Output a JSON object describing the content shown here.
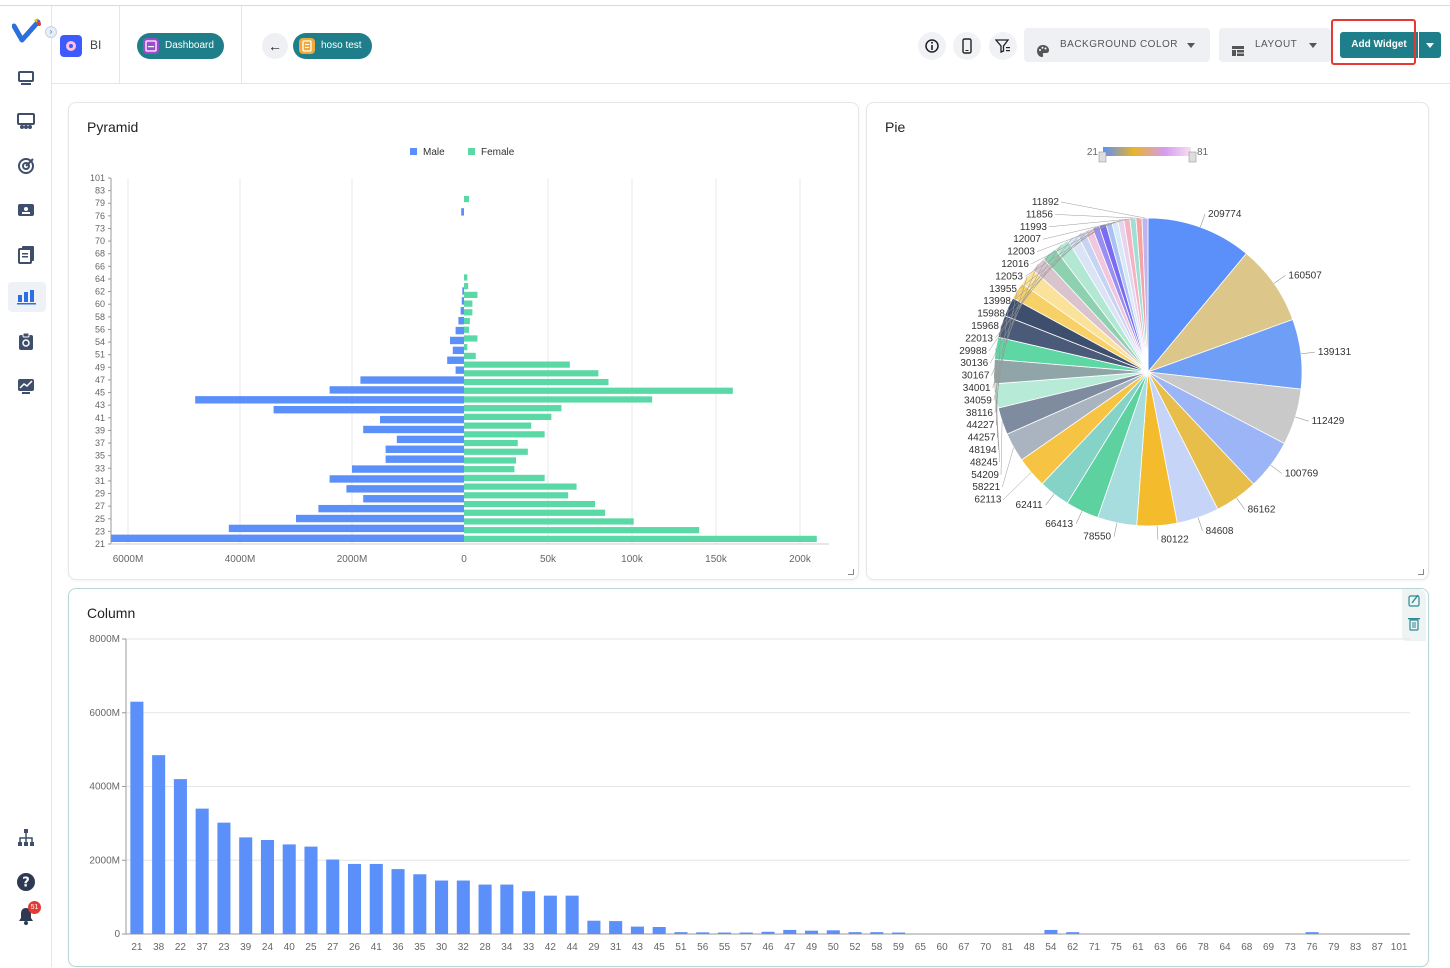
{
  "app": {
    "section_label": "BI"
  },
  "breadcrumb": {
    "dashboard_label": "Dashboard",
    "report_label": "hoso test"
  },
  "toolbar": {
    "background_color_label": "BACKGROUND COLOR",
    "layout_label": "LAYOUT",
    "add_widget_label": "Add Widget"
  },
  "sidebar": {
    "items": [
      {
        "icon": "monitor-icon"
      },
      {
        "icon": "people-icon"
      },
      {
        "icon": "target-icon"
      },
      {
        "icon": "id-card-icon"
      },
      {
        "icon": "documents-icon"
      },
      {
        "icon": "bar-chart-icon",
        "active": true
      },
      {
        "icon": "clipboard-icon"
      },
      {
        "icon": "line-chart-icon"
      },
      {
        "icon": "org-chart-icon"
      },
      {
        "icon": "help-icon"
      },
      {
        "icon": "bell-icon",
        "badge": "51"
      }
    ]
  },
  "widgets": {
    "pyramid": {
      "title": "Pyramid"
    },
    "pie": {
      "title": "Pie"
    },
    "column": {
      "title": "Column"
    }
  },
  "chart_data": [
    {
      "type": "bar",
      "orientation": "horizontal-diverging",
      "title": "Pyramid",
      "legend": {
        "position": "top-center",
        "entries": [
          "Male",
          "Female"
        ]
      },
      "colors": {
        "Male": "#5b8ff9",
        "Female": "#5ad8a6"
      },
      "categories": [
        "101",
        "83",
        "79",
        "76",
        "73",
        "70",
        "68",
        "66",
        "64",
        "62",
        "60",
        "58",
        "56",
        "54",
        "51",
        "49",
        "47",
        "45",
        "43",
        "41",
        "39",
        "37",
        "35",
        "33",
        "31",
        "29",
        "27",
        "25",
        "23",
        "21"
      ],
      "left_axis_ticks": [
        "6000M",
        "4000M",
        "2000M",
        "0"
      ],
      "right_axis_ticks": [
        "50k",
        "100k",
        "150k",
        "200k"
      ],
      "series": [
        {
          "name": "Male",
          "unit": "M",
          "values": [
            0,
            0,
            0,
            50,
            0,
            0,
            0,
            0,
            0,
            0,
            0,
            30,
            40,
            60,
            100,
            150,
            250,
            200,
            300,
            150,
            1850,
            2400,
            4800,
            3400,
            1500,
            1800,
            1200,
            1400,
            1400,
            2000,
            2400,
            2100,
            1800,
            2600,
            3000,
            4200,
            6300
          ]
        },
        {
          "name": "Female",
          "values": [
            0,
            0,
            3000,
            0,
            0,
            0,
            0,
            0,
            0,
            0,
            0,
            2000,
            2500,
            8000,
            5000,
            5000,
            3500,
            3000,
            8000,
            2000,
            7000,
            63000,
            80000,
            86000,
            160000,
            112000,
            58000,
            52000,
            40000,
            48000,
            32000,
            38000,
            31000,
            30000,
            48000,
            67000,
            62000,
            78000,
            84000,
            101000,
            140000,
            210000
          ]
        }
      ]
    },
    {
      "type": "pie",
      "title": "Pie",
      "range_slider": {
        "min_label": "21",
        "max_label": "81"
      },
      "values": [
        209774,
        160507,
        139131,
        112429,
        100769,
        86162,
        84608,
        80122,
        78550,
        66413,
        62411,
        62113,
        58221,
        54209,
        48245,
        48194,
        44257,
        44227,
        38116,
        34059,
        34001,
        30167,
        30136,
        29988,
        22013,
        15968,
        15988,
        13998,
        13955,
        12053,
        12016,
        12003,
        12007,
        11993,
        11856,
        11892
      ],
      "colors": [
        "#5b8ff9",
        "#dcc68a",
        "#6e9ef5",
        "#c9c9c9",
        "#9bb5f7",
        "#e8be4a",
        "#c5d4f7",
        "#f4bc2c",
        "#a8dde0",
        "#5dd2a0",
        "#85d3c6",
        "#f6c343",
        "#aab4c0",
        "#7f8ca0",
        "#b7ebd8",
        "#8fa5a8",
        "#5fd7a4",
        "#4b5a78",
        "#3e4f6e",
        "#f7d068",
        "#fbe29a",
        "#d9c3cd",
        "#8ed1b0",
        "#b1e7d3",
        "#dbe4f5",
        "#c7d3f2",
        "#f0c7dd",
        "#9a8ff0",
        "#7a6cf2",
        "#a9c2f3",
        "#d8e8f9",
        "#e6d5f0",
        "#f7b2c0",
        "#9fdfd6",
        "#f5a3a3",
        "#c1b3f0"
      ]
    },
    {
      "type": "bar",
      "title": "Column",
      "ylabel": "",
      "ylim": [
        0,
        8000
      ],
      "y_ticks": [
        "0",
        "2000M",
        "4000M",
        "6000M",
        "8000M"
      ],
      "categories": [
        "21",
        "38",
        "22",
        "37",
        "23",
        "39",
        "24",
        "40",
        "25",
        "27",
        "26",
        "41",
        "36",
        "35",
        "30",
        "32",
        "28",
        "34",
        "33",
        "42",
        "44",
        "29",
        "31",
        "43",
        "45",
        "51",
        "56",
        "55",
        "57",
        "46",
        "47",
        "49",
        "50",
        "52",
        "58",
        "59",
        "65",
        "60",
        "67",
        "70",
        "81",
        "48",
        "54",
        "62",
        "71",
        "75",
        "61",
        "63",
        "66",
        "78",
        "64",
        "68",
        "69",
        "73",
        "76",
        "79",
        "83",
        "87",
        "101"
      ],
      "values": [
        6300,
        4850,
        4200,
        3400,
        3020,
        2620,
        2550,
        2430,
        2370,
        2020,
        1900,
        1900,
        1760,
        1620,
        1450,
        1450,
        1340,
        1340,
        1160,
        1040,
        1040,
        360,
        350,
        200,
        190,
        50,
        45,
        40,
        40,
        60,
        110,
        90,
        100,
        50,
        50,
        40,
        0,
        0,
        0,
        0,
        0,
        0,
        110,
        50,
        0,
        0,
        0,
        0,
        0,
        0,
        0,
        0,
        0,
        0,
        50,
        0,
        0,
        0,
        0
      ],
      "color": "#5b8ff9"
    }
  ]
}
